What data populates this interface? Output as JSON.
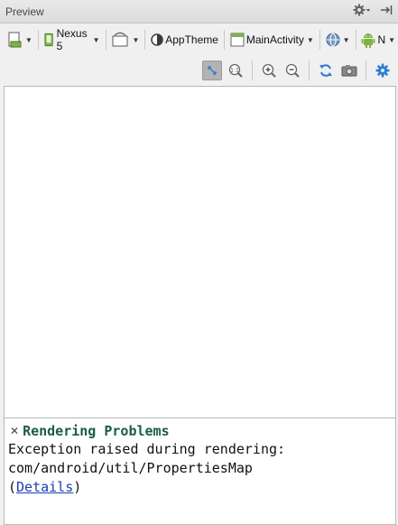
{
  "window": {
    "title": "Preview"
  },
  "toolbar": {
    "device": "Nexus 5",
    "theme": "AppTheme",
    "activity": "MainActivity",
    "api": "N"
  },
  "problems": {
    "heading": "Rendering Problems",
    "line1": "Exception raised during rendering:",
    "line2": "com/android/util/PropertiesMap",
    "open_paren": "(",
    "details_link": "Details",
    "close_paren": ")"
  },
  "colors": {
    "heading": "#1a5c4a",
    "link": "#1b3fb5",
    "android": "#7cb342",
    "refresh": "#2a7bd4"
  }
}
